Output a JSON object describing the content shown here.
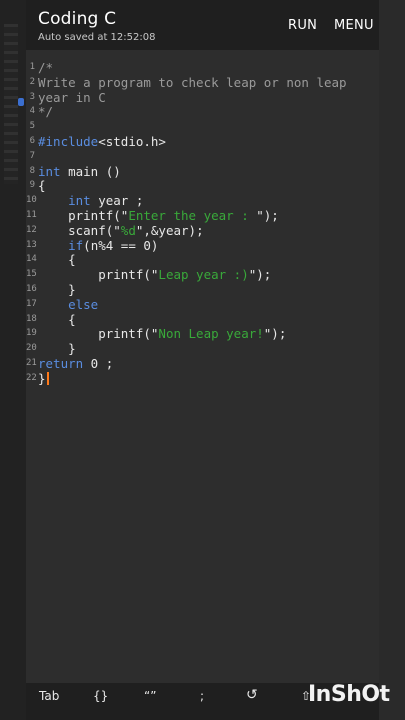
{
  "appbar": {
    "title": "Coding C",
    "subtitle": "Auto saved at 12:52:08",
    "actions": {
      "run": "RUN",
      "menu": "MENU"
    }
  },
  "editor": {
    "lines": [
      {
        "n": "1",
        "text": "/*"
      },
      {
        "n": "2",
        "text": "Write a program to check leap or non leap"
      },
      {
        "n": "3",
        "text": "year in C"
      },
      {
        "n": "4",
        "text": "*/"
      },
      {
        "n": "5",
        "text": ""
      },
      {
        "n": "6",
        "text": "#include<stdio.h>"
      },
      {
        "n": "7",
        "text": ""
      },
      {
        "n": "8",
        "text": "int main ()"
      },
      {
        "n": "9",
        "text": "{"
      },
      {
        "n": "10",
        "text": "    int year ;"
      },
      {
        "n": "11",
        "text": "    printf(\"Enter the year : \");"
      },
      {
        "n": "12",
        "text": "    scanf(\"%d\",&year);"
      },
      {
        "n": "13",
        "text": "    if(n%4 == 0)"
      },
      {
        "n": "14",
        "text": "    {"
      },
      {
        "n": "15",
        "text": "        printf(\"Leap year :)\");"
      },
      {
        "n": "16",
        "text": "    }"
      },
      {
        "n": "17",
        "text": "    else"
      },
      {
        "n": "18",
        "text": "    {"
      },
      {
        "n": "19",
        "text": "        printf(\"Non Leap year!\");"
      },
      {
        "n": "20",
        "text": "    }"
      },
      {
        "n": "21",
        "text": "return 0 ;"
      },
      {
        "n": "22",
        "text": "}"
      }
    ],
    "colors": {
      "keyword": "#5a8de0",
      "string": "#39a93a",
      "comment": "#9a9a9a",
      "cursor": "#ff7a1a"
    }
  },
  "toolbar": {
    "tab": "Tab",
    "brace": "{}",
    "quote": "“”",
    "semicolon": ";",
    "undo": "↺",
    "shift": "⇧"
  },
  "watermark": {
    "text": "InShOt"
  }
}
